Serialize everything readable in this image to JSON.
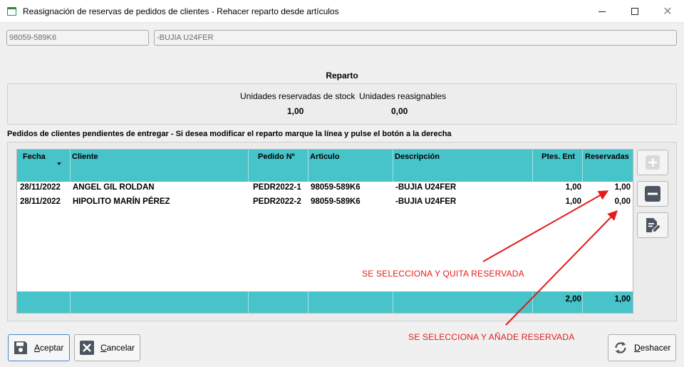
{
  "window": {
    "title": "Reasignación de reservas de pedidos de clientes - Rehacer reparto desde artículos",
    "minimize_glyph": "—",
    "maximize_glyph": "☐",
    "close_glyph": "✕"
  },
  "article": {
    "code": "98059-589K6",
    "description": "-BUJIA U24FER"
  },
  "reparto": {
    "title": "Reparto",
    "stock_label": "Unidades reservadas de stock",
    "reassign_label": "Unidades reasignables",
    "stock_value": "1,00",
    "reassign_value": "0,00"
  },
  "orders": {
    "section_label": "Pedidos de clientes pendientes de entregar - Si desea modificar el reparto marque la línea y pulse el botón a la derecha",
    "columns": {
      "fecha": "Fecha",
      "cliente": "Cliente",
      "pedido": "Pedido Nº",
      "articulo": "Articulo",
      "descripcion": "Descripción",
      "ptes": "Ptes. Ent",
      "reservadas": "Reservadas"
    },
    "rows": [
      {
        "fecha": "28/11/2022",
        "cliente": "ANGEL GIL ROLDAN",
        "pedido": "PEDR2022-1",
        "articulo": "98059-589K6",
        "descripcion": "-BUJIA U24FER",
        "ptes": "1,00",
        "reservadas": "1,00"
      },
      {
        "fecha": "28/11/2022",
        "cliente": "HIPOLITO MARÍN PÉREZ",
        "pedido": "PEDR2022-2",
        "articulo": "98059-589K6",
        "descripcion": "-BUJIA U24FER",
        "ptes": "1,00",
        "reservadas": "0,00"
      }
    ],
    "totals": {
      "ptes": "2,00",
      "reservadas": "1,00"
    }
  },
  "side_buttons": {
    "add_icon": "plus-icon",
    "remove_icon": "minus-icon",
    "edit_icon": "edit-document-icon"
  },
  "annotations": {
    "remove_note": "SE SELECCIONA Y QUITA RESERVADA",
    "add_note": "SE SELECCIONA Y AÑADE RESERVADA",
    "color": "#e31b1b"
  },
  "buttons": {
    "accept": {
      "first": "A",
      "rest": "ceptar"
    },
    "cancel": {
      "first": "C",
      "rest": "ancelar"
    },
    "undo": {
      "first": "D",
      "rest": "eshacer"
    }
  },
  "colors": {
    "grid_header": "#46c4c9",
    "accept_border": "#4a84c4"
  }
}
